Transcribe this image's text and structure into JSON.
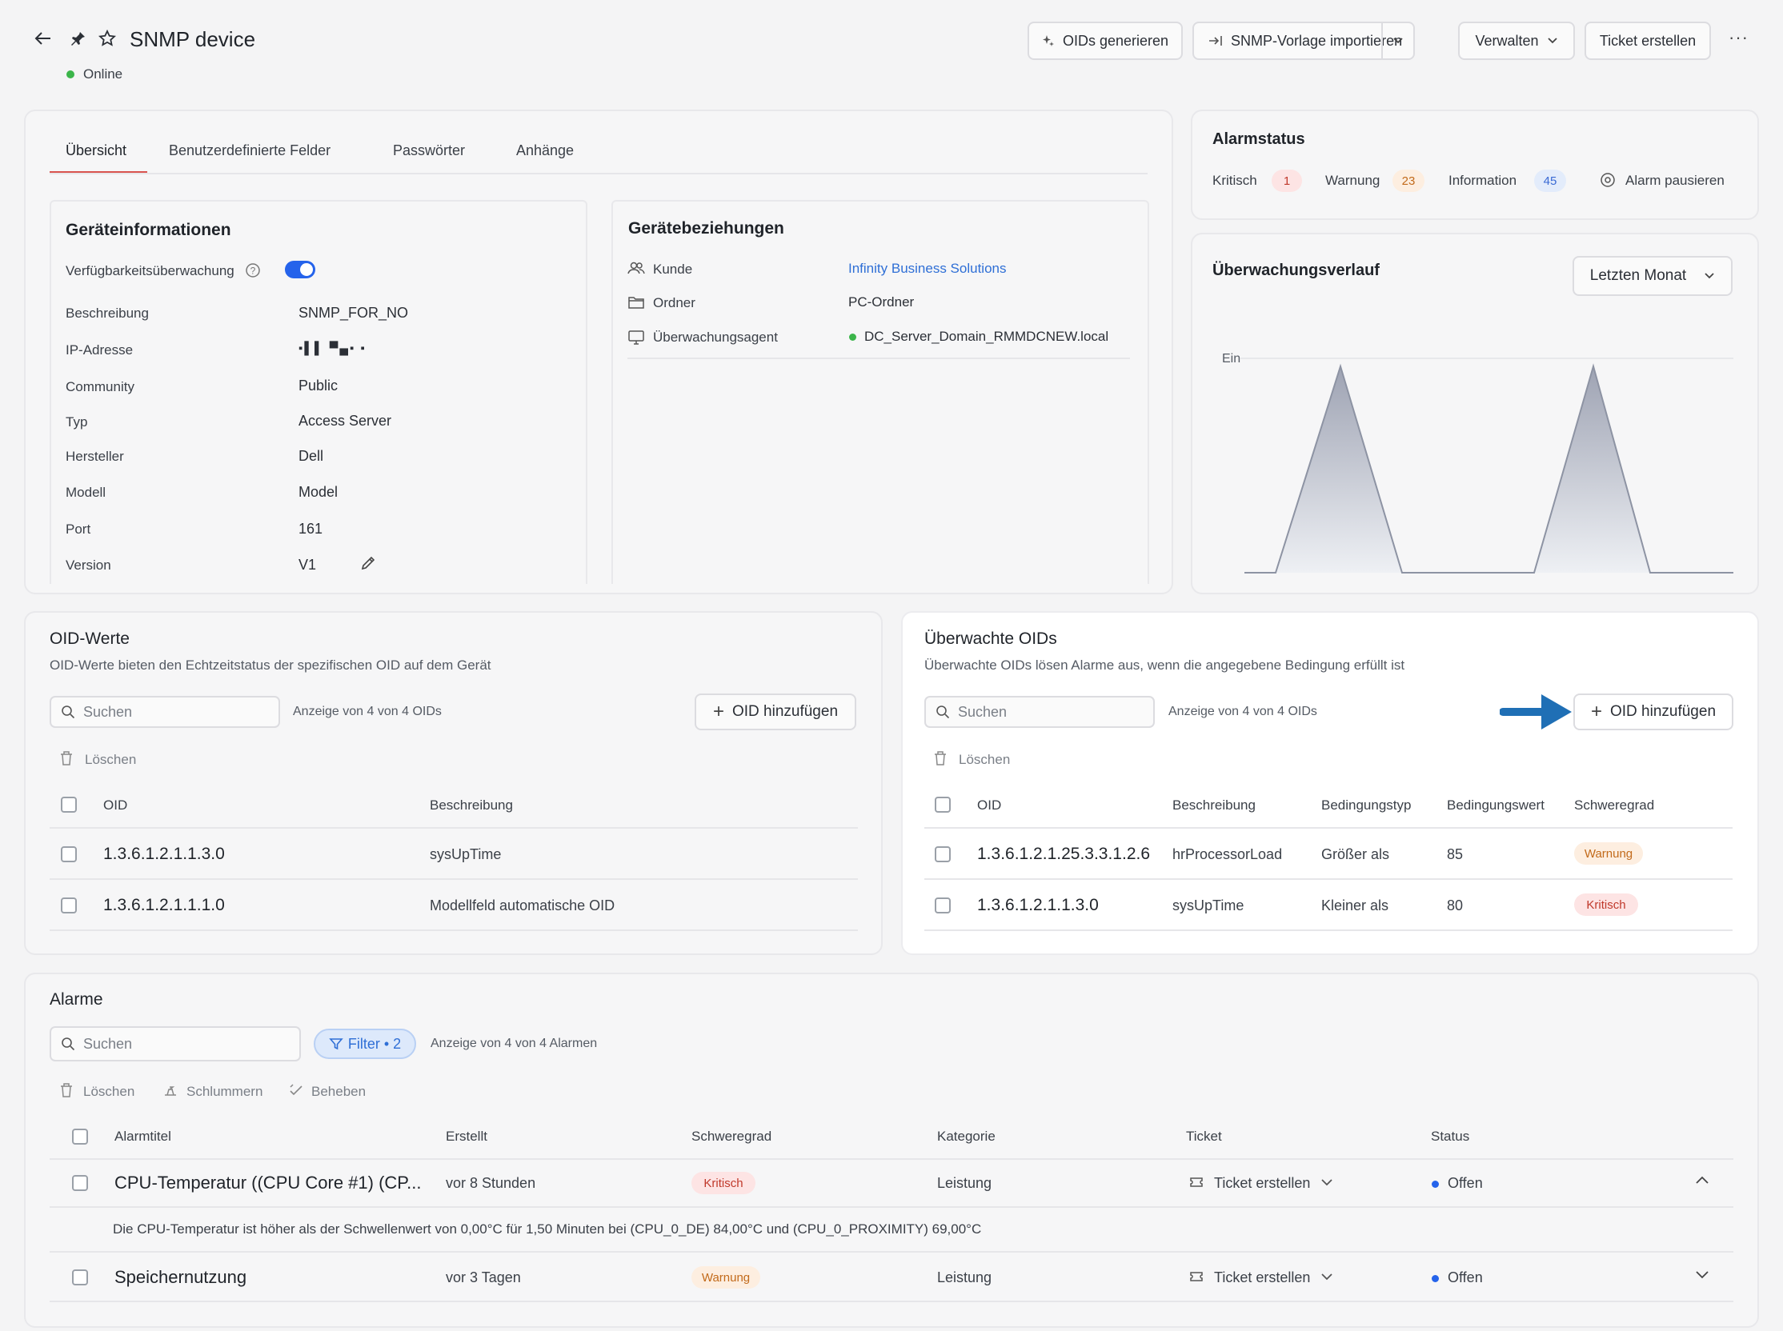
{
  "header": {
    "title": "SNMP device",
    "status": "Online",
    "actions": {
      "generate_oids": "OIDs generieren",
      "import_template": "SNMP-Vorlage importieren",
      "manage": "Verwalten",
      "create_ticket": "Ticket erstellen"
    }
  },
  "tabs": [
    "Übersicht",
    "Benutzerdefinierte Felder",
    "Passwörter",
    "Anhänge"
  ],
  "device_info": {
    "title": "Geräteinformationen",
    "availability_label": "Verfügbarkeitsüberwachung",
    "availability_on": true,
    "rows": [
      {
        "label": "Beschreibung",
        "value": "SNMP_FOR_NO"
      },
      {
        "label": "IP-Adresse",
        "value": "▪▌▌  ▀▄▪  ▪"
      },
      {
        "label": "Community",
        "value": "Public"
      },
      {
        "label": "Typ",
        "value": "Access Server"
      },
      {
        "label": "Hersteller",
        "value": "Dell"
      },
      {
        "label": "Modell",
        "value": "Model"
      },
      {
        "label": "Port",
        "value": "161"
      },
      {
        "label": "Version",
        "value": "V1"
      }
    ]
  },
  "relations": {
    "title": "Gerätebeziehungen",
    "rows": [
      {
        "label": "Kunde",
        "value": "Infinity Business Solutions",
        "icon": "users-icon"
      },
      {
        "label": "Ordner",
        "value": "PC-Ordner",
        "icon": "folder-icon"
      },
      {
        "label": "Überwachungsagent",
        "value": "DC_Server_Domain_RMMDCNEW.local",
        "icon": "monitor-icon"
      }
    ]
  },
  "alarm_status": {
    "title": "Alarmstatus",
    "critical_label": "Kritisch",
    "critical_count": "1",
    "warning_label": "Warnung",
    "warning_count": "23",
    "info_label": "Information",
    "info_count": "45",
    "pause_label": "Alarm pausieren"
  },
  "history": {
    "title": "Überwachungsverlauf",
    "range": "Letzten Monat",
    "y_label": "Ein"
  },
  "oid_values": {
    "title": "OID-Werte",
    "subtitle": "OID-Werte bieten den Echtzeitstatus der spezifischen OID auf dem Gerät",
    "search_placeholder": "Suchen",
    "count_text": "Anzeige von 4 von 4 OIDs",
    "add_label": "OID hinzufügen",
    "delete_label": "Löschen",
    "columns": [
      "OID",
      "Beschreibung"
    ],
    "rows": [
      {
        "oid": "1.3.6.1.2.1.1.3.0",
        "desc": "sysUpTime"
      },
      {
        "oid": "1.3.6.1.2.1.1.1.0",
        "desc": "Modellfeld automatische OID"
      }
    ]
  },
  "watched_oids": {
    "title": "Überwachte OIDs",
    "subtitle": "Überwachte OIDs lösen Alarme aus, wenn die angegebene Bedingung erfüllt ist",
    "search_placeholder": "Suchen",
    "count_text": "Anzeige von 4 von 4 OIDs",
    "add_label": "OID hinzufügen",
    "delete_label": "Löschen",
    "columns": [
      "OID",
      "Beschreibung",
      "Bedingungstyp",
      "Bedingungswert",
      "Schweregrad"
    ],
    "rows": [
      {
        "oid": "1.3.6.1.2.1.25.3.3.1.2.6",
        "desc": "hrProcessorLoad",
        "type": "Größer als",
        "value": "85",
        "severity": "Warnung"
      },
      {
        "oid": "1.3.6.1.2.1.1.3.0",
        "desc": "sysUpTime",
        "type": "Kleiner als",
        "value": "80",
        "severity": "Kritisch"
      }
    ]
  },
  "alarms": {
    "title": "Alarme",
    "search_placeholder": "Suchen",
    "filter_label": "Filter • 2",
    "count_text": "Anzeige von 4 von 4 Alarmen",
    "actions": {
      "delete": "Löschen",
      "snooze": "Schlummern",
      "resolve": "Beheben"
    },
    "columns": [
      "Alarmtitel",
      "Erstellt",
      "Schweregrad",
      "Kategorie",
      "Ticket",
      "Status"
    ],
    "rows": [
      {
        "title": "CPU-Temperatur ((CPU Core #1) (CP...",
        "created": "vor 8 Stunden",
        "severity": "Kritisch",
        "category": "Leistung",
        "ticket": "Ticket erstellen",
        "status": "Offen",
        "detail": "Die CPU-Temperatur ist höher als der Schwellenwert von 0,00°C für 1,50 Minuten bei (CPU_0_DE) 84,00°C und (CPU_0_PROXIMITY) 69,00°C"
      },
      {
        "title": "Speichernutzung",
        "created": "vor 3 Tagen",
        "severity": "Warnung",
        "category": "Leistung",
        "ticket": "Ticket erstellen",
        "status": "Offen"
      }
    ]
  },
  "colors": {
    "accent": "#2563eb",
    "online": "#3bb54a",
    "link": "#2f6fd6",
    "arrow": "#1f6fb5"
  }
}
